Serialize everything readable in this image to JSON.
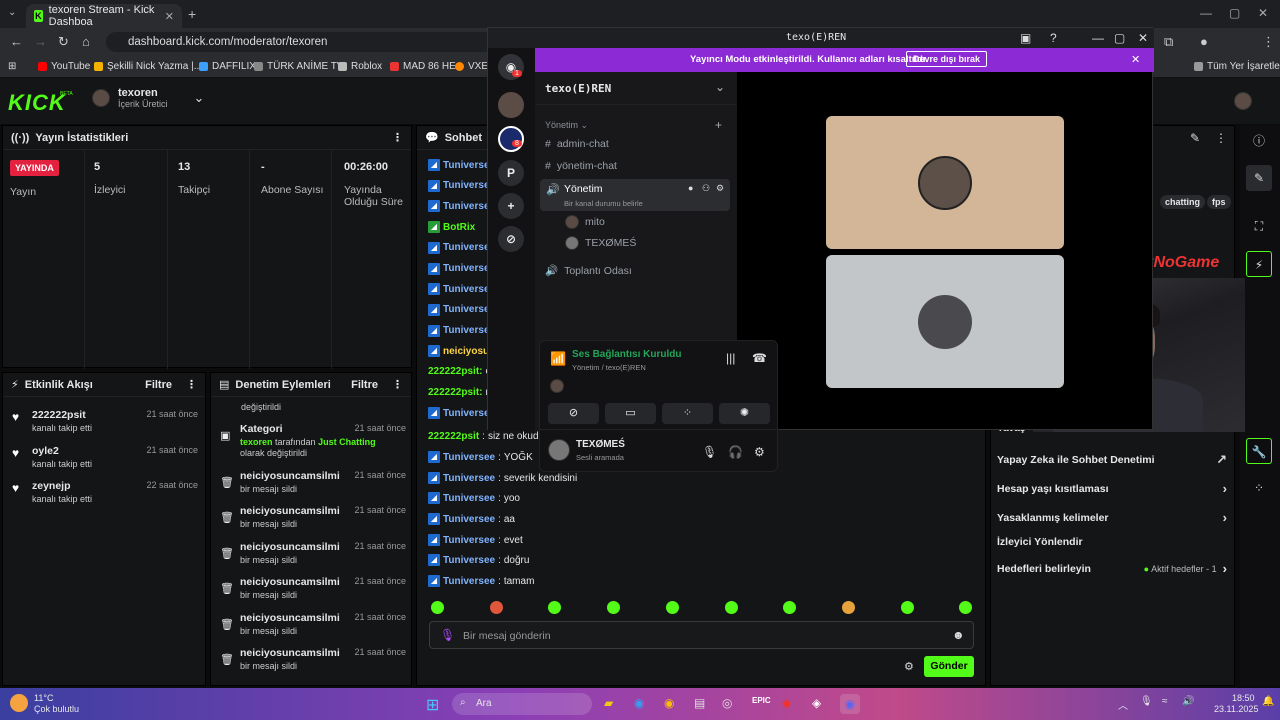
{
  "browser": {
    "tab_title": "texoren Stream - Kick Dashboa",
    "url": "dashboard.kick.com/moderator/texoren",
    "bookmarks": [
      "YouTube",
      "Şekilli Nick Yazma |...",
      "DAFFILIX",
      "TÜRK ANİME TV",
      "Roblox",
      "MAD 86 HE",
      "VXE"
    ],
    "all_bookmarks": "Tüm Yer İşaretleri"
  },
  "kick": {
    "logo": "KICK",
    "beta": "BETA",
    "username": "texoren",
    "role": "İçerik Üretici"
  },
  "stats": {
    "title": "Yayın İstatistikleri",
    "live_badge": "YAYINDA",
    "live_label": "Yayın",
    "items": [
      {
        "value": "5",
        "label": "İzleyici"
      },
      {
        "value": "13",
        "label": "Takipçi"
      },
      {
        "value": "-",
        "label": "Abone Sayısı"
      },
      {
        "value": "00:26:00",
        "label": "Yayında Olduğu Süre"
      }
    ]
  },
  "activity": {
    "title": "Etkinlik Akışı",
    "filter": "Filtre",
    "items": [
      {
        "name": "222222psit",
        "desc": "kanalı takip etti",
        "time": "21 saat önce"
      },
      {
        "name": "oyle2",
        "desc": "kanalı takip etti",
        "time": "21 saat önce"
      },
      {
        "name": "zeynejp",
        "desc": "kanalı takip etti",
        "time": "22 saat önce"
      }
    ]
  },
  "moderation": {
    "title": "Denetim Eylemleri",
    "filter": "Filtre",
    "top_text": "değiştirildi",
    "category": {
      "name": "Kategori",
      "time": "21 saat önce",
      "who": "texoren",
      "mid": "tarafından",
      "cat": "Just Chatting",
      "tail": "olarak",
      "end": "değiştirildi"
    },
    "items": [
      {
        "name": "neiciyosuncamsilmi",
        "desc": "bir mesajı sildi",
        "time": "21 saat önce"
      },
      {
        "name": "neiciyosuncamsilmi",
        "desc": "bir mesajı sildi",
        "time": "21 saat önce"
      },
      {
        "name": "neiciyosuncamsilmi",
        "desc": "bir mesajı sildi",
        "time": "21 saat önce"
      },
      {
        "name": "neiciyosuncamsilmi",
        "desc": "bir mesajı sildi",
        "time": "21 saat önce"
      },
      {
        "name": "neiciyosuncamsilmi",
        "desc": "bir mesajı sildi",
        "time": "21 saat önce"
      },
      {
        "name": "neiciyosuncamsilmi",
        "desc": "bir mesajı sildi",
        "time": "21 saat önce"
      }
    ]
  },
  "chat": {
    "title": "Sohbet",
    "top_users": [
      "Tuniverse",
      "Tuniverse",
      "Tuniverse",
      "BotRix",
      "Tuniverse",
      "Tuniverse",
      "Tuniverse",
      "Tuniverse",
      "Tuniverse",
      "neiciyosur",
      "222222psit:",
      "222222psit:",
      "Tuniverse"
    ],
    "top_msgs": [
      "",
      "",
      "",
      "",
      "",
      "",
      "",
      "",
      "",
      "",
      "e",
      "n",
      ""
    ],
    "messages": [
      {
        "user": "222222psit",
        "msg": "siz ne okudunuz ya da okuyorsunuz",
        "color": "green"
      },
      {
        "user": "Tuniversee",
        "msg": "YOĞK",
        "color": "blue"
      },
      {
        "user": "Tuniversee",
        "msg": "severik kendisini",
        "color": "blue"
      },
      {
        "user": "Tuniversee",
        "msg": "yoo",
        "color": "blue"
      },
      {
        "user": "Tuniversee",
        "msg": "aa",
        "color": "blue"
      },
      {
        "user": "Tuniversee",
        "msg": "evet",
        "color": "blue"
      },
      {
        "user": "Tuniversee",
        "msg": "doğru",
        "color": "blue"
      },
      {
        "user": "Tuniversee",
        "msg": "tamam",
        "color": "blue"
      }
    ],
    "placeholder": "Bir mesaj gönderin",
    "send": "Gönder"
  },
  "right_panel": {
    "tags": [
      "chatting",
      "fps"
    ],
    "watermark": "ByNoGame",
    "partial": "Yavaş",
    "rows": [
      {
        "label": "Yapay Zeka ile Sohbet Denetimi",
        "right": "↗"
      },
      {
        "label": "Hesap yaşı kısıtlaması",
        "right": "›"
      },
      {
        "label": "Yasaklanmış kelimeler",
        "right": "›"
      },
      {
        "label": "İzleyici Yönlendir",
        "right": ""
      },
      {
        "label": "Hedefleri belirleyin",
        "right": "›"
      }
    ],
    "goals_status": "Aktif hedefler - 1"
  },
  "discord": {
    "title": "texo(E)REN",
    "banner": "Yayıncı Modu etkinleştirildi. Kullanıcı adları kısaltıldı.",
    "banner_btn": "Devre dışı bırak",
    "server_name": "texo(E)REN",
    "category": "Yönetim",
    "channels": [
      "admin-chat",
      "yönetim-chat"
    ],
    "voice_channel": "Yönetim",
    "voice_status": "Bir kanal durumu belirle",
    "members": [
      "mito",
      "TEXØMEŚ"
    ],
    "other_voice": "Toplantı Odası",
    "connection": "Ses Bağlantısı Kuruldu",
    "connection_sub": "Yönetim / texo(E)REN",
    "me": "TEXØMEŚ",
    "me_status": "Sesli aramada",
    "server_letter": "P",
    "badge1": "1",
    "badge2": "8"
  },
  "taskbar": {
    "temp": "11°C",
    "weather": "Çok bulutlu",
    "search": "Ara",
    "time": "18:50",
    "date": "23.11.2025"
  }
}
